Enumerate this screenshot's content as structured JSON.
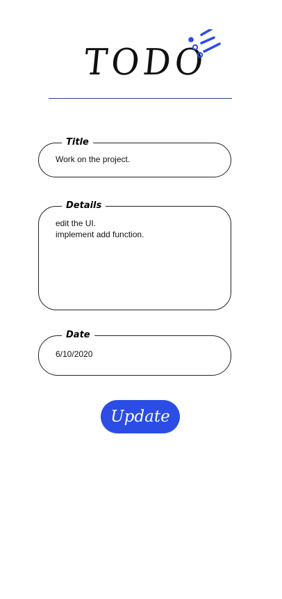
{
  "header": {
    "logo_text": "TODO",
    "accent_color": "#2b4de6",
    "logo_mark_icon": "todo-list-icon"
  },
  "form": {
    "title": {
      "legend": "Title",
      "value": "Work on the project."
    },
    "details": {
      "legend": "Details",
      "value": "edit the UI.\nimplement add function."
    },
    "date": {
      "legend": "Date",
      "value": "6/10/2020"
    },
    "update_label": "Update"
  }
}
